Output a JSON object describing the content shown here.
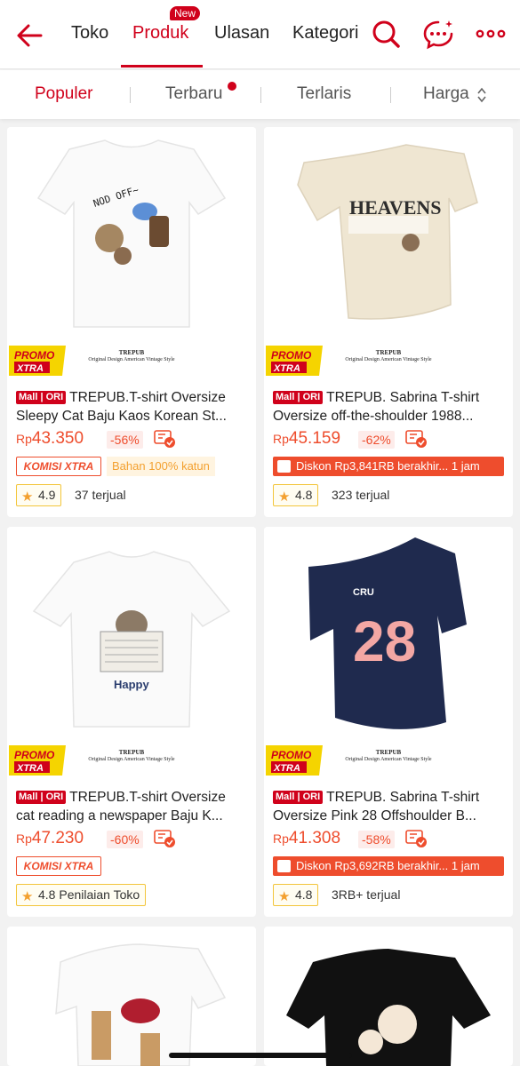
{
  "header": {
    "tabs": [
      {
        "label": "Toko"
      },
      {
        "label": "Produk",
        "badge": "New"
      },
      {
        "label": "Ulasan"
      },
      {
        "label": "Kategori"
      }
    ]
  },
  "sort": {
    "items": [
      {
        "label": "Populer"
      },
      {
        "label": "Terbaru"
      },
      {
        "label": "Terlaris"
      },
      {
        "label": "Harga"
      }
    ]
  },
  "products": [
    {
      "brand_line1": "TREPUB",
      "brand_line2": "Original Design American Vintage Style",
      "promo": "PROMO XTRA",
      "mall": "Mall | ORI",
      "title1": "TREPUB.T-shirt Oversize",
      "title2": "Sleepy Cat Baju Kaos Korean St...",
      "currency": "Rp",
      "price": "43.350",
      "discount": "-56%",
      "komisi": "KOMISI XTRA",
      "tag": "Bahan 100% katun",
      "rating": "4.9",
      "sold": "37 terjual",
      "art_text": "NOD OFF~"
    },
    {
      "brand_line1": "TREPUB",
      "brand_line2": "Original Design American Vintage Style",
      "promo": "PROMO XTRA",
      "mall": "Mall | ORI",
      "title1": "TREPUB. Sabrina T-shirt",
      "title2": "Oversize off-the-shoulder 1988...",
      "currency": "Rp",
      "price": "45.159",
      "discount": "-62%",
      "diskon": "Diskon Rp3,841RB berakhir... 1 jam",
      "rating": "4.8",
      "sold": "323 terjual",
      "art_text": "HEAVENS"
    },
    {
      "brand_line1": "TREPUB",
      "brand_line2": "Original Design American Vintage Style",
      "promo": "PROMO XTRA",
      "mall": "Mall | ORI",
      "title1": "TREPUB.T-shirt Oversize",
      "title2": "cat reading a newspaper Baju K...",
      "currency": "Rp",
      "price": "47.230",
      "discount": "-60%",
      "komisi": "KOMISI XTRA",
      "rating": "4.8 Penilaian Toko",
      "art_text": "Happy"
    },
    {
      "brand_line1": "TREPUB",
      "brand_line2": "Original Design American Vintage Style",
      "promo": "PROMO XTRA",
      "mall": "Mall | ORI",
      "title1": "TREPUB. Sabrina T-shirt",
      "title2": "Oversize Pink 28 Offshoulder B...",
      "currency": "Rp",
      "price": "41.308",
      "discount": "-58%",
      "diskon": "Diskon Rp3,692RB berakhir... 1 jam",
      "rating": "4.8",
      "sold": "3RB+ terjual",
      "art_text": "28",
      "art_text2": "CRU"
    }
  ],
  "colors": {
    "accent": "#d0011b",
    "price": "#ee4d2d"
  }
}
